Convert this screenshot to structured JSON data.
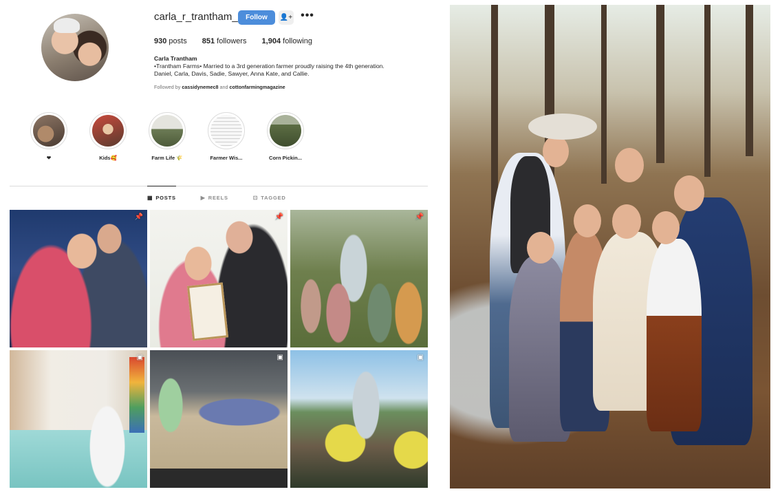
{
  "profile": {
    "username": "carla_r_trantham_",
    "follow_label": "Follow",
    "more_label": "•••",
    "add_user_label": "+",
    "stats": {
      "posts_count": "930",
      "posts_label": "posts",
      "followers_count": "851",
      "followers_label": "followers",
      "following_count": "1,904",
      "following_label": "following"
    },
    "bio": {
      "name": "Carla Trantham",
      "line1": "•Trantham Farms• Married to a 3rd generation farmer proudly raising the 4th generation.",
      "line2": "Daniel, Carla, Davis, Sadie, Sawyer, Anna Kate, and Callie."
    },
    "followed_by": {
      "prefix": "Followed by",
      "user1": "cassidynemec8",
      "and": "and",
      "user2": "cottonfarmingmagazine"
    }
  },
  "highlights": [
    {
      "label": "❤"
    },
    {
      "label": "Kids🥰"
    },
    {
      "label": "Farm Life 🌾"
    },
    {
      "label": "Farmer Wis..."
    },
    {
      "label": "Corn Pickin..."
    }
  ],
  "tabs": [
    {
      "label": "POSTS",
      "icon": "grid-icon",
      "active": true
    },
    {
      "label": "REELS",
      "icon": "reels-icon",
      "active": false
    },
    {
      "label": "TAGGED",
      "icon": "tagged-icon",
      "active": false
    }
  ],
  "posts": [
    {
      "badge": "📌",
      "badge_icon": "pin-icon"
    },
    {
      "badge": "📌",
      "badge_icon": "pin-icon"
    },
    {
      "badge": "📌",
      "badge_icon": "pin-icon"
    },
    {
      "badge": "▣",
      "badge_icon": "reel-icon"
    },
    {
      "badge": "▣",
      "badge_icon": "reel-icon"
    },
    {
      "badge": "▣",
      "badge_icon": "reel-icon"
    }
  ],
  "colors": {
    "follow_button": "#4c8ddb",
    "text_primary": "#262626",
    "text_secondary": "#737373",
    "divider": "#dbdbdb"
  }
}
